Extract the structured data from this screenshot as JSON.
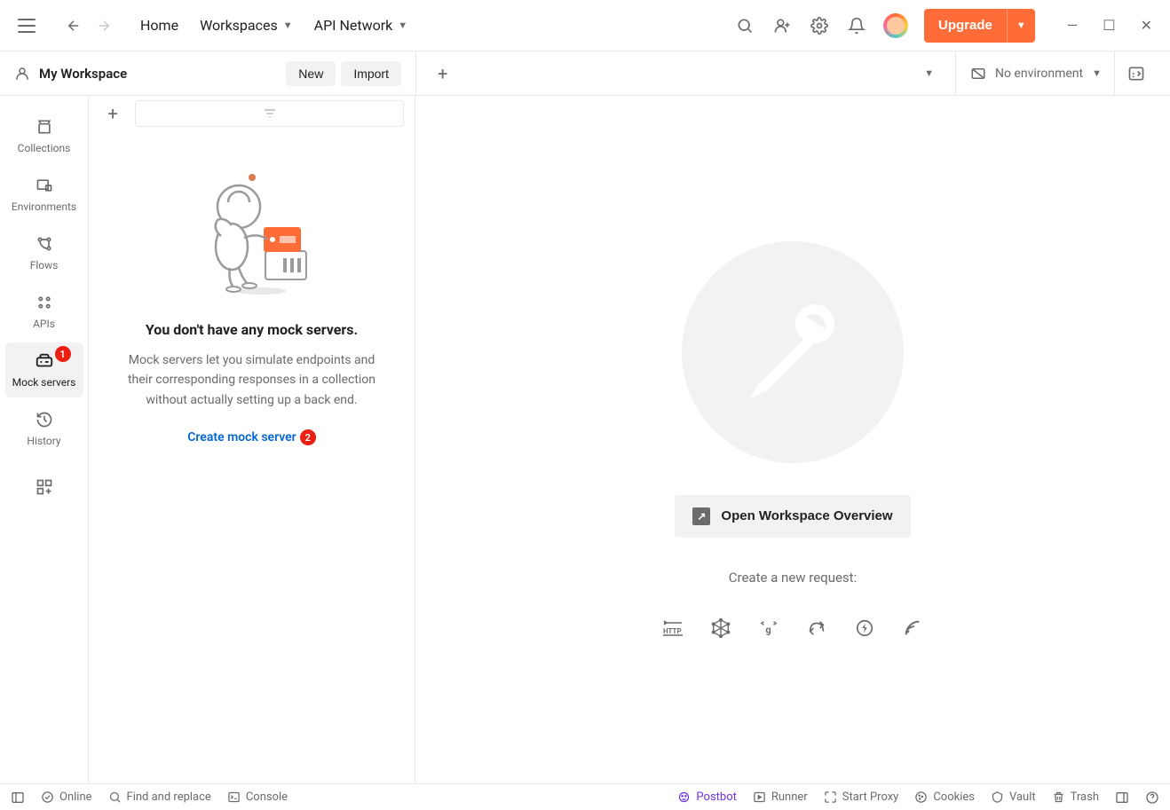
{
  "topbar": {
    "nav": {
      "home": "Home",
      "workspaces": "Workspaces",
      "api_network": "API Network"
    },
    "upgrade": "Upgrade"
  },
  "workspace": {
    "name": "My Workspace",
    "new_btn": "New",
    "import_btn": "Import",
    "no_environment": "No environment"
  },
  "rail": {
    "collections": "Collections",
    "environments": "Environments",
    "flows": "Flows",
    "apis": "APIs",
    "mock_servers": "Mock servers",
    "mock_badge": "1",
    "history": "History"
  },
  "empty_state": {
    "title": "You don't have any mock servers.",
    "desc": "Mock servers let you simulate endpoints and their corresponding responses in a collection without actually setting up a back end.",
    "link": "Create mock server",
    "link_badge": "2"
  },
  "content": {
    "open_overview": "Open Workspace Overview",
    "create_label": "Create a new request:"
  },
  "statusbar": {
    "online": "Online",
    "find": "Find and replace",
    "console": "Console",
    "postbot": "Postbot",
    "runner": "Runner",
    "proxy": "Start Proxy",
    "cookies": "Cookies",
    "vault": "Vault",
    "trash": "Trash"
  }
}
